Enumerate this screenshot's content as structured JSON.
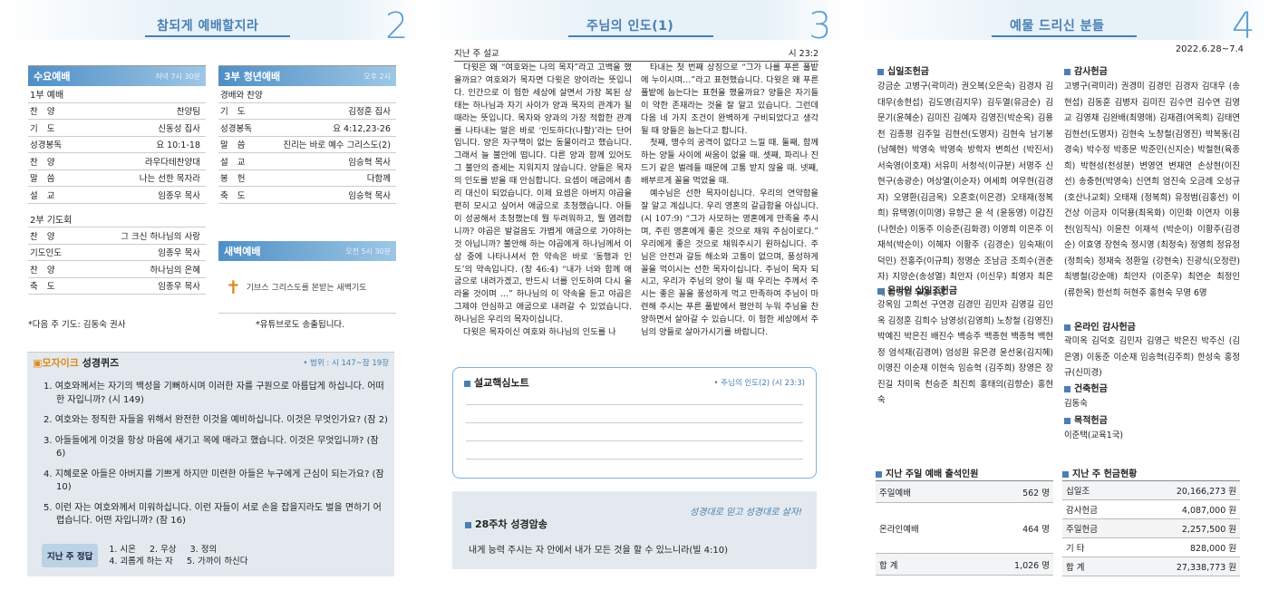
{
  "pages": [
    {
      "title": "참되게 예배할지라",
      "number": "2"
    },
    {
      "title": "주님의 인도(1)",
      "number": "3"
    },
    {
      "title": "예물 드리신 분들",
      "number": "4"
    }
  ],
  "p1": {
    "sunday": {
      "title": "수요예배",
      "time": "저녁 7시 30분",
      "sec1": "1부 예배",
      "rows1": [
        [
          "찬양",
          "찬양팀"
        ],
        [
          "기도",
          "신동성 집사"
        ],
        [
          "성경봉독",
          "요 10:1-18"
        ],
        [
          "찬양",
          "라우다테찬양대"
        ],
        [
          "말씀",
          "나는 선한 목자라"
        ],
        [
          "설교",
          "임종우 목사"
        ]
      ],
      "sec2": "2부 기도회",
      "rows2": [
        [
          "찬양",
          "그 크신 하나님의 사랑"
        ],
        [
          "기도인도",
          "임종우 목사"
        ],
        [
          "찬양",
          "하나님의 은혜"
        ],
        [
          "축도",
          "임종우 목사"
        ]
      ],
      "foot": "*다음 주 기도: 김동숙 권사"
    },
    "youth": {
      "title": "3부 청년예배",
      "time": "오후 2시",
      "rows": [
        [
          "경배와 찬양",
          ""
        ],
        [
          "기도",
          "김정훈 집사"
        ],
        [
          "성경봉독",
          "요 4:12,23-26"
        ],
        [
          "말씀",
          "진리는 바로 예수 그리스도(2)"
        ],
        [
          "설교",
          "임승혁 목사"
        ],
        [
          "봉헌",
          "다함께"
        ],
        [
          "축도",
          "임승혁 목사"
        ]
      ]
    },
    "dawn": {
      "title": "새벽예배",
      "time": "오전 5시 30분",
      "logo_text": "기브스  그리스도를 본받는 새벽기도",
      "foot": "*유튜브로도 송출됩니다."
    },
    "quiz": {
      "mosaic": "모자이크",
      "title": "성경퀴즈",
      "range": "• 범위 : 시 147~잠 19장",
      "questions": [
        "1. 여호와께서는 자기의 백성을 기뻐하시며 이러한 자를 구원으로 아름답게 하십니다. 어떠한 자입니까? (시 149)",
        "2. 여호와는 정직한 자들을 위해서 완전한 이것을 예비하십니다. 이것은 무엇인가요? (잠 2)",
        "3. 아들들에게 이것을 항상 마음에 새기고 목에 매라고 했습니다. 이것은 무엇입니까? (잠 6)",
        "4. 지혜로운 아들은 아버지를 기쁘게 하지만 미련한 아들은 누구에게 근심이 되는가요? (잠 10)",
        "5. 이런 자는 여호와께서 미워하십니다. 이런 자들이 서로 손을 잡을지라도 벌을 면하기 어렵습니다. 어떤 자입니까? (잠 16)"
      ],
      "answer_label": "지난 주 정답",
      "answer_line1": "1. 시온     2. 우상     3. 정의",
      "answer_line2": "4. 괴롭게 하는 자     5. 가까이 하신다"
    }
  },
  "p2": {
    "label": "지난 주 설교",
    "ref": "시 23:2",
    "col1": [
      "다윗은 왜 “여호와는 나의 목자”라고 고백을 했을까요? 여호와가 목자면 다윗은 양이라는 뜻입니다. 인간으로 이 험한 세상에 살면서 가장 복된 상태는 하나님과 자기 사이가 양과 목자의 관계가 될 때라는 뜻입니다. 목자와 양과의 가장 적합한 관계를 나타내는 말은 바로 ‘인도하다(나할)’라는 단어입니다. 양은 자구책이 없는 동물이라고 했습니다. 그래서 늘 불안에 떱니다. 다른 양과 함께 있어도 그 불안의 증세는 지워지지 않습니다. 양들은 목자의 인도를 받을 때 안심합니다. 요셉이 애굽에서 총리 대신이 되었습니다. 이제 요셉은 아버지 야곱을 편히 모시고 싶어서 애굽으로 초청했습니다. 아들이 성공해서 초청했는데 뭘 두려워하고, 뭘 염려합니까? 야곱은 발걸음도 가볍게 애굽으로 가야하는 것 아닙니까? 불안해 하는 야곱에게 하나님께서 이상 중에 나타나셔서 한 약속은 바로 ‘동행과 인도’의 약속입니다. (창 46:4) “내가 너와 함께 애굽으로 내려가겠고, 반드시 너를 인도하여 다시 올라올 것이며 …” 하나님의 이 약속을 듣고 야곱은 그제야 안심하고 애굽으로 내려갈 수 있었습니다. 하나님은 우리의 목자이십니다.",
      "다윗은 목자이신 여호와 하나님의 인도를 나"
    ],
    "col2": [
      "타내는 첫 번째 상징으로 “그가 나를 푸른 풀밭에 누이시며…”라고 표현했습니다. 다윗은 왜 푸른 풀밭에 눕는다는 표현을 했을까요? 양들은 자기들이 약한 존재라는 것을 잘 알고 있습니다. 그런데 다음 네 가지 조건이 완벽하게 구비되었다고 생각될 때 양들은 눕는다고 합니다.",
      "첫째, 맹수의 공격이 없다고 느낄 때. 둘째, 함께 하는 양들 사이에 싸움이 없을 때. 셋째, 파리나 진드기 같은 벌레들 때문에 고통 받지 않을 때. 넷째, 배부르게 꼴을 먹었을 때.",
      "예수님은 선한 목자이십니다. 우리의 연약함을 잘 알고 계십니다. 우리 영혼의 갈급함을 아십니다. (시 107:9) “그가 사모하는 영혼에게 만족을 주시며, 주린 영혼에게 좋은 것으로 채워 주심이로다.” 우리에게 좋은 것으로 채워주시기 원하십니다. 주님은 안전과 갈등 해소와 고통이 없으며, 풍성하게 꼴을 먹이시는 선한 목자이십니다. 주님이 목자 되시고, 우리가 주님의 양이 될 때 우리는 주께서 주시는 좋은 꼴을 풍성하게 먹고 만족하여 주님이 마련해 주시는 푸른 풀밭에서 평안히 누워 주님을 찬양하면서 살아갈 수 있습니다. 이 험한 세상에서 주님의 양들로 살아가시기를 바랍니다."
    ],
    "note": {
      "title": "설교핵심노트",
      "ref": "• 주님의 인도(2) (시 23:3)"
    },
    "memory": {
      "slogan": "성경대로 믿고 성경대로 살자!",
      "title": "28주차 성경암송",
      "verse": "내게 능력 주시는 자 안에서 내가 모든 것을 할 수 있느니라(빌 4:10)"
    }
  },
  "p3": {
    "date": "2022.6.28~7.4",
    "tithe_title": "십일조헌금",
    "tithe_names": "강금순 고병구(곽미라) 권오복(오은숙) 김경자 김대우(송현섭) 김도영(김지우) 김두열(유금순) 김문기(윤혜순) 김미진 김예자 김영진(박순옥) 김용천 김종평 김주일 김현선(도명자) 김현숙 남기봉(남혜현) 박영숙 박영숙 방학자 변희선 (박진서) 서숙영(이호재) 서유미 서청석(이규분) 서명주 신현구(송광순) 여상열(이순자) 여세희 여우현(김경자) 오명환(김금옥) 오혼호(이은경) 오태재(정복희) 유택영(이미영) 유향근 윤 석 (윤동영) 이갑진(나현순) 이동주 이승준(김화경) 이영희 이은주 이재석(박순이) 이혜자 이황주 (김경순) 임숙재(이덕민) 전홍주(이규희) 정명순 조남금 조희수(권춘자) 지양순(송성열) 최안자 (이신우) 최영자 최은혜 황병현 무명 1명",
    "online_tithe_title": "온라인 십일조헌금",
    "online_tithe_names": "강옥임 고희선 구연경 김경민 김민자 김영길 김인옥 김정훈 김희수 남영성(김영희) 노창철 (김영진) 박예진 박은진 배진수 백승주 백종현 백종혁 백현정 엄석재(김경여) 엄성원 유은경 윤선웅(김지혜) 이명진 이순재 이현숙 임승혁 (김주희) 장영은 장진길 차미옥 천승준 최진희 홍태의(김향순) 홍현숙",
    "thanks_title": "감사헌금",
    "thanks_names": "고병구(곽미라) 권경미 김경민 김경자 김대우 (송현섭) 김동훈 김병자 김미진 김수연 김수연 김영교 김영채 김완배(최명애) 김재겸(여옥희) 김태연 김현선(도명자) 김현숙 노창철(김영진) 박복동(김경숙) 박수정 박종문 박준민(신지순) 박철현(육종희) 박현성(천성분) 변영연 변재연 손상현(이진선) 송충현(박영숙) 신연희 엄진숙 오금례 오성규(호산나교회) 오태재 (정복희) 유정범(김홍선) 이건상 이금자 이덕용(최옥화) 이민화 이연자 이용천(임직식) 이윤찬 이재석 (박순이) 이황주(김경순) 이효영 장현숙 정시영 (최정숙) 정영희 정유정(정희숙) 정재숙 정환일 (강현숙) 진광식(오정란) 최병철(강순애) 최안자 (이준우) 최연순 최정인(류한옥) 한선희 허현주 홍현숙 무명 6명",
    "online_thanks_title": "온라인 감사헌금",
    "online_thanks_names": "곽미옥 김덕호 김민자 김영근 박은진 박주신 (김은영) 이동준 이순재 임승혁(김주희) 한성숙 홍정규(신미경)",
    "building_title": "건축헌금",
    "building_names": "김동숙",
    "mission_title": "목적헌금",
    "mission_names": "이준택(교육1국)",
    "attendance": {
      "title": "지난 주일 예배 출석인원",
      "rows": [
        [
          "주일예배",
          "562 명"
        ],
        [
          "온라인예배",
          "464 명"
        ],
        [
          "합 계",
          "1,026 명"
        ]
      ]
    },
    "offering": {
      "title": "지난 주 헌금현황",
      "rows": [
        [
          "십일조",
          "20,166,273 원"
        ],
        [
          "감사헌금",
          "4,087,000 원"
        ],
        [
          "주일헌금",
          "2,257,500 원"
        ],
        [
          "기 타",
          "828,000 원"
        ],
        [
          "합 계",
          "27,338,773 원"
        ]
      ]
    }
  }
}
